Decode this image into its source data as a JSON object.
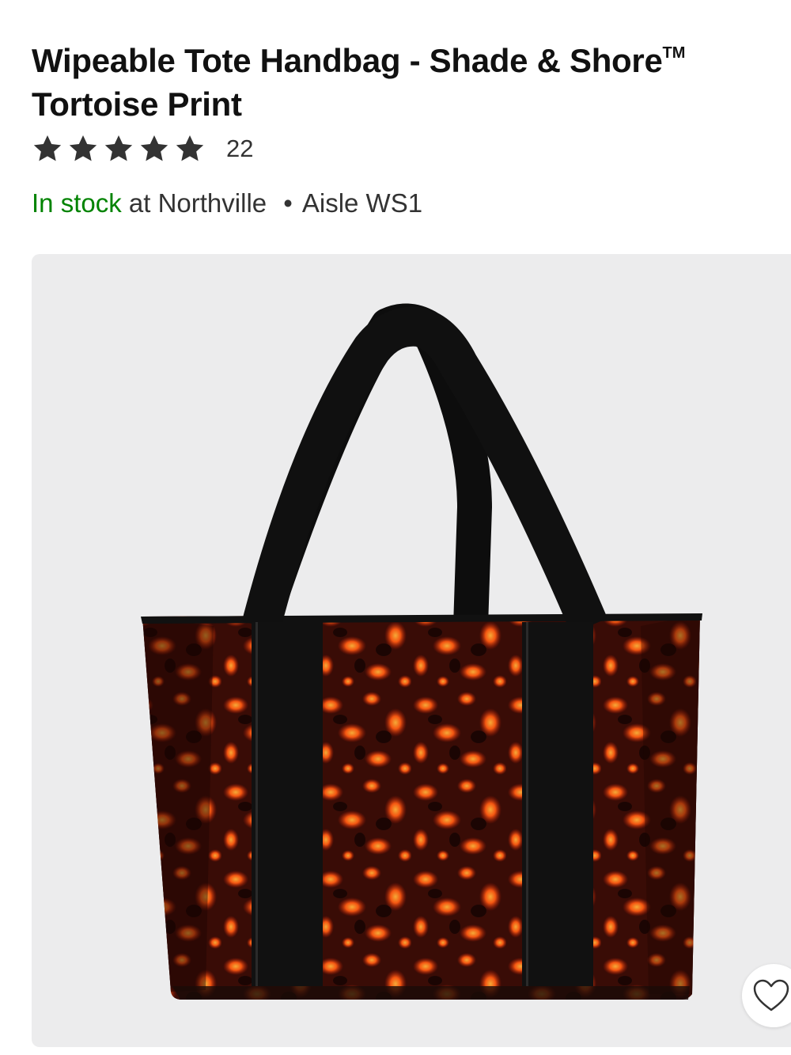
{
  "product": {
    "title_main": "Wipeable Tote Handbag - Shade & Shore",
    "title_trademark": "TM",
    "title_line2": "Tortoise Print"
  },
  "rating": {
    "stars": 5,
    "star_color": "#333333",
    "review_count": "22"
  },
  "availability": {
    "status": "In stock",
    "store_text": "at Northville",
    "separator": "•",
    "aisle": "Aisle WS1",
    "status_color": "#008300"
  },
  "image": {
    "icon": "tortoise-tote-bag-image",
    "background_color": "#ececed"
  },
  "favorite": {
    "icon": "heart-outline-icon"
  }
}
